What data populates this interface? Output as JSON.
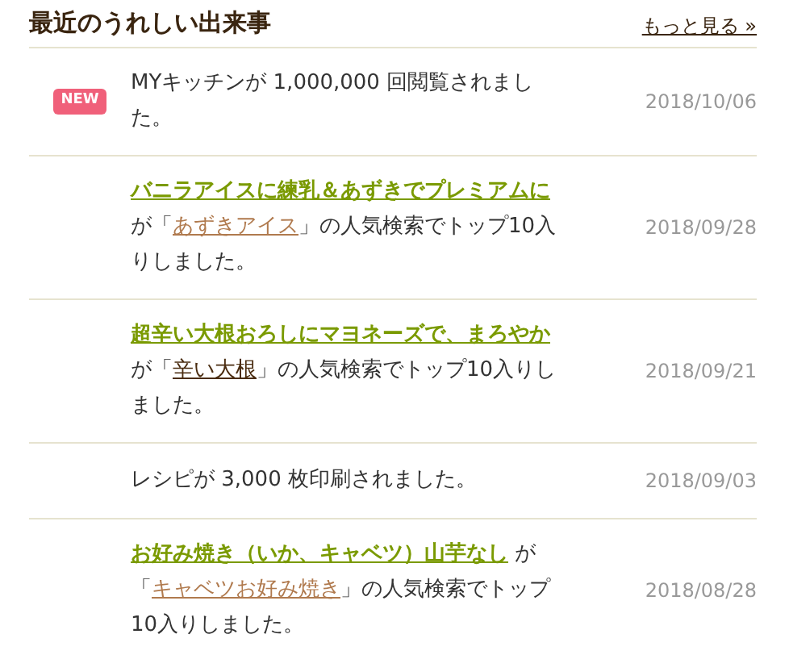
{
  "header": {
    "title": "最近のうれしい出来事",
    "more_link": "もっと見る »"
  },
  "events": [
    {
      "new": true,
      "date": "2018/10/06",
      "parts": [
        {
          "kind": "text",
          "text": "MYキッチンが 1,000,000 回閲覧されました。"
        }
      ]
    },
    {
      "new": false,
      "date": "2018/09/28",
      "parts": [
        {
          "kind": "recipe",
          "text": "バニラアイスに練乳＆あずきでプレミアムに"
        },
        {
          "kind": "text",
          "text": "が「"
        },
        {
          "kind": "keyword",
          "text": "あずきアイス",
          "visited": false
        },
        {
          "kind": "text",
          "text": "」の人気検索でトップ10入りしました。"
        }
      ]
    },
    {
      "new": false,
      "date": "2018/09/21",
      "parts": [
        {
          "kind": "recipe",
          "text": "超辛い大根おろしにマヨネーズで、まろやか"
        },
        {
          "kind": "text",
          "text": "が「"
        },
        {
          "kind": "keyword",
          "text": "辛い大根",
          "visited": true
        },
        {
          "kind": "text",
          "text": "」の人気検索でトップ10入りしました。"
        }
      ]
    },
    {
      "new": false,
      "date": "2018/09/03",
      "parts": [
        {
          "kind": "text",
          "text": "レシピが 3,000 枚印刷されました。"
        }
      ]
    },
    {
      "new": false,
      "date": "2018/08/28",
      "parts": [
        {
          "kind": "recipe",
          "text": "お好み焼き（いか、キャベツ）山芋なし"
        },
        {
          "kind": "text",
          "text": " が「"
        },
        {
          "kind": "keyword",
          "text": "キャベツお好み焼き",
          "visited": false
        },
        {
          "kind": "text",
          "text": "」の人気検索でトップ10入りしました。"
        }
      ]
    }
  ],
  "new_badge": "NEW"
}
